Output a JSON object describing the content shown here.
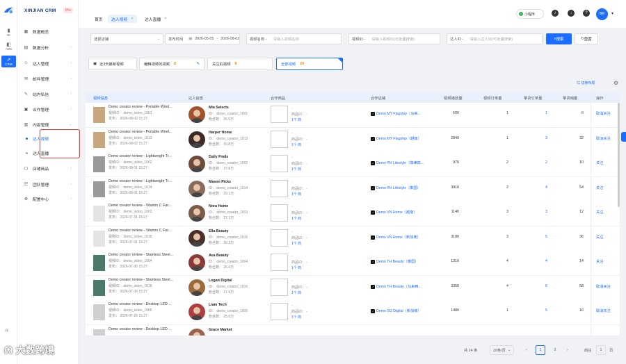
{
  "rail": {
    "items": [
      {
        "label": "BI",
        "icon": "bar-chart-icon"
      },
      {
        "label": "ADS",
        "icon": "ads-icon"
      },
      {
        "label": "CRM",
        "icon": "crm-icon"
      }
    ]
  },
  "sidebar": {
    "brand": "XINJIAN CRM",
    "pro": "Pro",
    "menu": [
      {
        "label": "数据概览"
      },
      {
        "label": "数据分析"
      },
      {
        "label": "达人管理"
      },
      {
        "label": "邮件管理"
      },
      {
        "label": "站内私信"
      },
      {
        "label": "合作管理"
      },
      {
        "label": "内容管理"
      },
      {
        "label": "店铺商品"
      },
      {
        "label": "团队管理"
      },
      {
        "label": "配置中心"
      }
    ],
    "submenu": [
      {
        "label": "达人视频"
      },
      {
        "label": "达人直播"
      }
    ],
    "watermark": "大数跨境"
  },
  "topbar": {
    "tabs": [
      {
        "label": "首页"
      },
      {
        "label": "达人视频"
      },
      {
        "label": "达人直播"
      }
    ],
    "mini_program": "小程序",
    "avatar_text": "BR"
  },
  "filters": {
    "shop_select": "选择店铺",
    "time_label": "发布时间",
    "date_start": "2026-05-05",
    "date_sep": "-",
    "date_end": "2026-08-02",
    "video_name_label": "视频名称",
    "video_name_placeholder": "请输入视频名称",
    "video_id_label": "视频ID",
    "video_id_placeholder": "请输入视频ID(可批量搜索)",
    "creator_id_label": "达人ID",
    "creator_id_placeholder": "请输入达人ID(可批量搜索)",
    "search": "搜索",
    "reset": "重置"
  },
  "quick_filters": [
    {
      "label": "近3天最新视频",
      "count": ""
    },
    {
      "label": "编辑视频的视频",
      "count": "8"
    },
    {
      "label": "关注的视频",
      "count": "8"
    },
    {
      "label": "全部视频",
      "count": "24"
    }
  ],
  "tools": {
    "column_settings": "切换布局"
  },
  "table": {
    "headers": [
      "视频信息",
      "达人信息",
      "合作商品",
      "合作店铺",
      "视频播放量",
      "视频订单量",
      "带货订单量",
      "带货销量",
      "操作"
    ],
    "rows": [
      {
        "title": "Demo creator review - Portable Wirel...",
        "vid": "视频ID：  demo_video_1001",
        "pub": "发布：  2026-08-02 15:27",
        "cname": "Mia Selects",
        "cid": "ID：  demo_creator_1001",
        "fans": "粉丝数：  26.6万",
        "pline1": "-",
        "pline2": "商品ID：  -",
        "pline3": "1个 商",
        "shop": "Demo MY Flagship（马来...",
        "plays": "600",
        "vorders": "1",
        "sorders": "1",
        "sales": "6",
        "op": "取消关注",
        "thumb": "#c9a77c",
        "av": "#a0522d"
      },
      {
        "title": "Demo creator review - Portable Wirel...",
        "vid": "视频ID：  demo_video_1013",
        "pub": "发布：  2026-08-02 15:27",
        "cname": "Harper Home",
        "cid": "ID：  demo_creator_1013",
        "fans": "粉丝数：  19.8万",
        "pline1": "-",
        "pline2": "商品ID：  -",
        "pline3": "1个 商",
        "shop": "Demo MY Flagship（越南）",
        "plays": "2840",
        "vorders": "1",
        "sorders": "3",
        "sales": "32",
        "op": "取消关注",
        "thumb": "#c9a77c",
        "av": "#3b2a25"
      },
      {
        "title": "Demo creator review - Lightweight Tr...",
        "vid": "视频ID：  demo_video_1002",
        "pub": "发布：  2026-08-01 15:27",
        "cname": "Daily Finds",
        "cid": "ID：  demo_creator_1002",
        "fans": "粉丝数：  27.8万",
        "pline1": "-",
        "pline2": "商品ID：  -",
        "pline3": "1个 商",
        "shop": "Demo PH Lifestyle（菲律宾...",
        "plays": "970",
        "vorders": "2",
        "sorders": "2",
        "sales": "10",
        "op": "关注",
        "thumb": "#9a9a9a",
        "av": "#6d4c3d"
      },
      {
        "title": "Demo creator review - Lightweight Tr...",
        "vid": "视频ID：  demo_video_1014",
        "pub": "发布：  2026-08-01 15:27",
        "cname": "Mason Picks",
        "cid": "ID：  demo_creator_1014",
        "fans": "粉丝数：  19.1万",
        "pline1": "-",
        "pline2": "商品ID：  -",
        "pline3": "1个 商",
        "shop": "Demo PH Lifestyle（泰国）",
        "plays": "3010",
        "vorders": "2",
        "sorders": "4",
        "sales": "54",
        "op": "关注",
        "thumb": "#9a9a9a",
        "av": "#8a6a5a"
      },
      {
        "title": "Demo creator review - Vitamin C Fac...",
        "vid": "视频ID：  demo_video_1003",
        "pub": "发布：  2026-07-31 15:27",
        "cname": "Nora Home",
        "cid": "ID：  demo_creator_1003",
        "fans": "粉丝数：  27.1万",
        "pline1": "-",
        "pline2": "商品ID：  -",
        "pline3": "1个 商",
        "shop": "Demo VN Home（越南）",
        "plays": "1140",
        "vorders": "3",
        "sorders": "3",
        "sales": "12",
        "op": "关注",
        "thumb": "#e4e4e4",
        "av": "#7a5a4a"
      },
      {
        "title": "Demo creator review - Vitamin C Fac...",
        "vid": "视频ID：  demo_video_1015",
        "pub": "发布：  2026-07-31 15:27",
        "cname": "Ella Beauty",
        "cid": "ID：  demo_creator_1015",
        "fans": "粉丝数：  18.3万",
        "pline1": "-",
        "pline2": "商品ID：  -",
        "pline3": "1个 商",
        "shop": "Demo VN Home（新加坡）",
        "plays": "3180",
        "vorders": "3",
        "sorders": "5",
        "sales": "36",
        "op": "关注",
        "thumb": "#e4e4e4",
        "av": "#4a3028"
      },
      {
        "title": "Demo creator review - Stainless Steel...",
        "vid": "视频ID：  demo_video_1004",
        "pub": "发布：  2026-07-30 15:27",
        "cname": "Ava Beauty",
        "cid": "ID：  demo_creator_1004",
        "fans": "粉丝数：  26.4万",
        "pline1": "-",
        "pline2": "商品ID：  -",
        "pline3": "1个 商",
        "shop": "Demo TH Beauty（泰国）",
        "plays": "1310",
        "vorders": "4",
        "sorders": "4",
        "sales": "14",
        "op": "关注",
        "thumb": "#4a7a6a",
        "av": "#8b3a3a"
      },
      {
        "title": "Demo creator review - Stainless Steel...",
        "vid": "视频ID：  demo_video_1016",
        "pub": "发布：  2026-07-30 15:27",
        "cname": "Logan Digital",
        "cid": "ID：  demo_creator_1016",
        "fans": "粉丝数：  17.6万",
        "pline1": "-",
        "pline2": "商品ID：  -",
        "pline3": "1个 商",
        "shop": "Demo TH Beauty（马来西...",
        "plays": "3350",
        "vorders": "4",
        "sorders": "6",
        "sales": "58",
        "op": "取消关注",
        "thumb": "#4a7a6a",
        "av": "#9a6a3a"
      },
      {
        "title": "Demo creator review - Desktop LED ...",
        "vid": "视频ID：  demo_video_1005",
        "pub": "发布：  2026-07-29 15:27",
        "cname": "Liam Tech",
        "cid": "ID：  demo_creator_1005",
        "fans": "粉丝数：  25.6万",
        "pline1": "-",
        "pline2": "商品ID：  -",
        "pline3": "1个 商",
        "shop": "Demo SG Digital（新加坡）",
        "plays": "1480",
        "vorders": "1",
        "sorders": "5",
        "sales": "16",
        "op": "取消关注",
        "thumb": "#cfcfcf",
        "av": "#b04040"
      },
      {
        "title": "Demo creator review - Desktop LED ...",
        "vid": "",
        "pub": "",
        "cname": "Grace Market",
        "cid": "",
        "fans": "",
        "pline1": "",
        "pline2": "",
        "pline3": "",
        "shop": "",
        "plays": "",
        "vorders": "",
        "sorders": "",
        "sales": "",
        "op": "",
        "thumb": "#cfcfcf",
        "av": "#a06050"
      }
    ]
  },
  "pager": {
    "total": "共 24 条",
    "page_size": "20条/页",
    "pages": [
      "1",
      "2"
    ],
    "goto_label": "前往",
    "goto_value": "1",
    "unit": "页"
  },
  "colors": {
    "accent": "#1a6dff",
    "highlight_border": "#e53935",
    "count": "#f08c00"
  }
}
